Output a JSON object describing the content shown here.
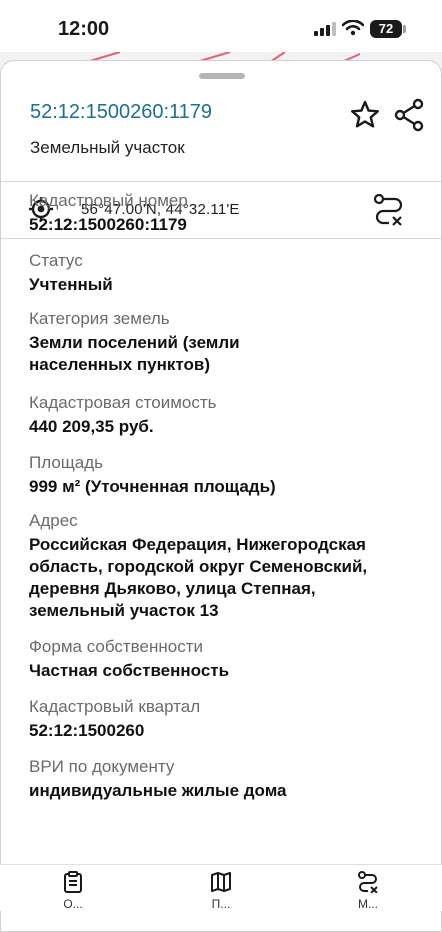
{
  "status_bar": {
    "time": "12:00",
    "battery": "72"
  },
  "header": {
    "cadastral_title": "52:12:1500260:1179",
    "subtitle": "Земельный участок"
  },
  "coordinates": "56°47.00'N, 44°32.11'E",
  "fields": [
    {
      "label": "Кадастровый номер",
      "value": "52:12:1500260:1179"
    },
    {
      "label": "Статус",
      "value": "Учтенный"
    },
    {
      "label": "Категория земель",
      "value": "Земли поселений (земли\nнаселенных пунктов)"
    },
    {
      "label": "Кадастровая стоимость",
      "value": "440 209,35 руб."
    },
    {
      "label": "Площадь",
      "value": "999 м² (Уточненная площадь)"
    },
    {
      "label": "Адрес",
      "value": "Российская Федерация, Нижегородская\nобласть, городской округ Семеновский,\nдеревня Дьяково, улица  Степная,\nземельный участок 13"
    },
    {
      "label": "Форма собственности",
      "value": "Частная собственность"
    },
    {
      "label": "Кадастровый квартал",
      "value": "52:12:1500260"
    },
    {
      "label": "ВРИ по документу",
      "value": "индивидуальные жилые дома"
    }
  ],
  "icons": {
    "star": "star-icon",
    "share": "share-icon",
    "target": "target-icon",
    "route": "route-icon",
    "clipboard": "clipboard-icon",
    "map": "map-icon",
    "sliders": "route-icon"
  },
  "tabs": [
    {
      "label": "Ο..."
    },
    {
      "label": "П..."
    },
    {
      "label": "М..."
    }
  ],
  "colors": {
    "accent": "#1d6f8f",
    "label_gray": "#6b6b6b"
  }
}
